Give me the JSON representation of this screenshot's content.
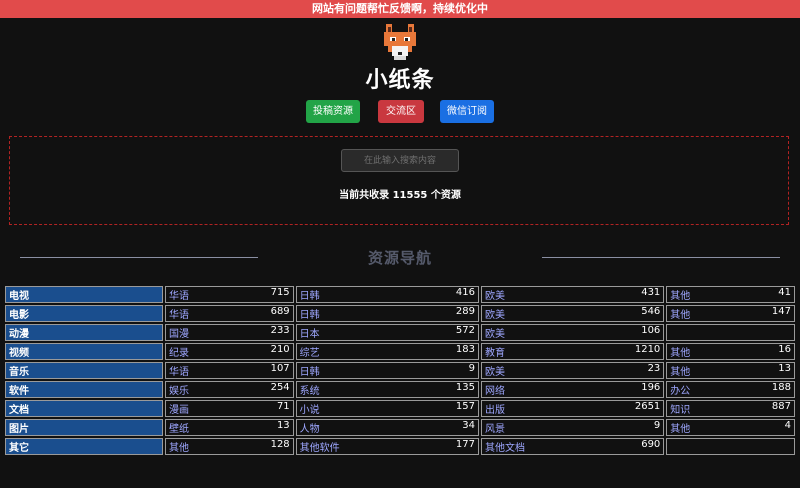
{
  "notice": "网站有问题帮忙反馈啊，持续优化中",
  "site": {
    "title": "小纸条"
  },
  "buttons": {
    "submit": "投稿资源",
    "forum": "交流区",
    "wechat": "微信订阅"
  },
  "search": {
    "placeholder": "在此输入搜索内容",
    "stats": "当前共收录 11555 个资源"
  },
  "nav": {
    "title": "资源导航",
    "rows": [
      {
        "category": "电视",
        "subs": [
          {
            "name": "华语",
            "count": "715"
          },
          {
            "name": "日韩",
            "count": "416"
          },
          {
            "name": "欧美",
            "count": "431"
          },
          {
            "name": "其他",
            "count": "41"
          }
        ]
      },
      {
        "category": "电影",
        "subs": [
          {
            "name": "华语",
            "count": "689"
          },
          {
            "name": "日韩",
            "count": "289"
          },
          {
            "name": "欧美",
            "count": "546"
          },
          {
            "name": "其他",
            "count": "147"
          }
        ]
      },
      {
        "category": "动漫",
        "subs": [
          {
            "name": "国漫",
            "count": "233"
          },
          {
            "name": "日本",
            "count": "572"
          },
          {
            "name": "欧美",
            "count": "106"
          }
        ]
      },
      {
        "category": "视频",
        "subs": [
          {
            "name": "纪录",
            "count": "210"
          },
          {
            "name": "综艺",
            "count": "183"
          },
          {
            "name": "教育",
            "count": "1210"
          },
          {
            "name": "其他",
            "count": "16"
          }
        ]
      },
      {
        "category": "音乐",
        "subs": [
          {
            "name": "华语",
            "count": "107"
          },
          {
            "name": "日韩",
            "count": "9"
          },
          {
            "name": "欧美",
            "count": "23"
          },
          {
            "name": "其他",
            "count": "13"
          }
        ]
      },
      {
        "category": "软件",
        "subs": [
          {
            "name": "娱乐",
            "count": "254"
          },
          {
            "name": "系统",
            "count": "135"
          },
          {
            "name": "网络",
            "count": "196"
          },
          {
            "name": "办公",
            "count": "188"
          }
        ]
      },
      {
        "category": "文档",
        "subs": [
          {
            "name": "漫画",
            "count": "71"
          },
          {
            "name": "小说",
            "count": "157"
          },
          {
            "name": "出版",
            "count": "2651"
          },
          {
            "name": "知识",
            "count": "887"
          }
        ]
      },
      {
        "category": "图片",
        "subs": [
          {
            "name": "壁纸",
            "count": "13"
          },
          {
            "name": "人物",
            "count": "34"
          },
          {
            "name": "风景",
            "count": "9"
          },
          {
            "name": "其他",
            "count": "4"
          }
        ]
      },
      {
        "category": "其它",
        "subs": [
          {
            "name": "其他",
            "count": "128"
          },
          {
            "name": "其他软件",
            "count": "177"
          },
          {
            "name": "其他文档",
            "count": "690"
          }
        ]
      }
    ]
  }
}
